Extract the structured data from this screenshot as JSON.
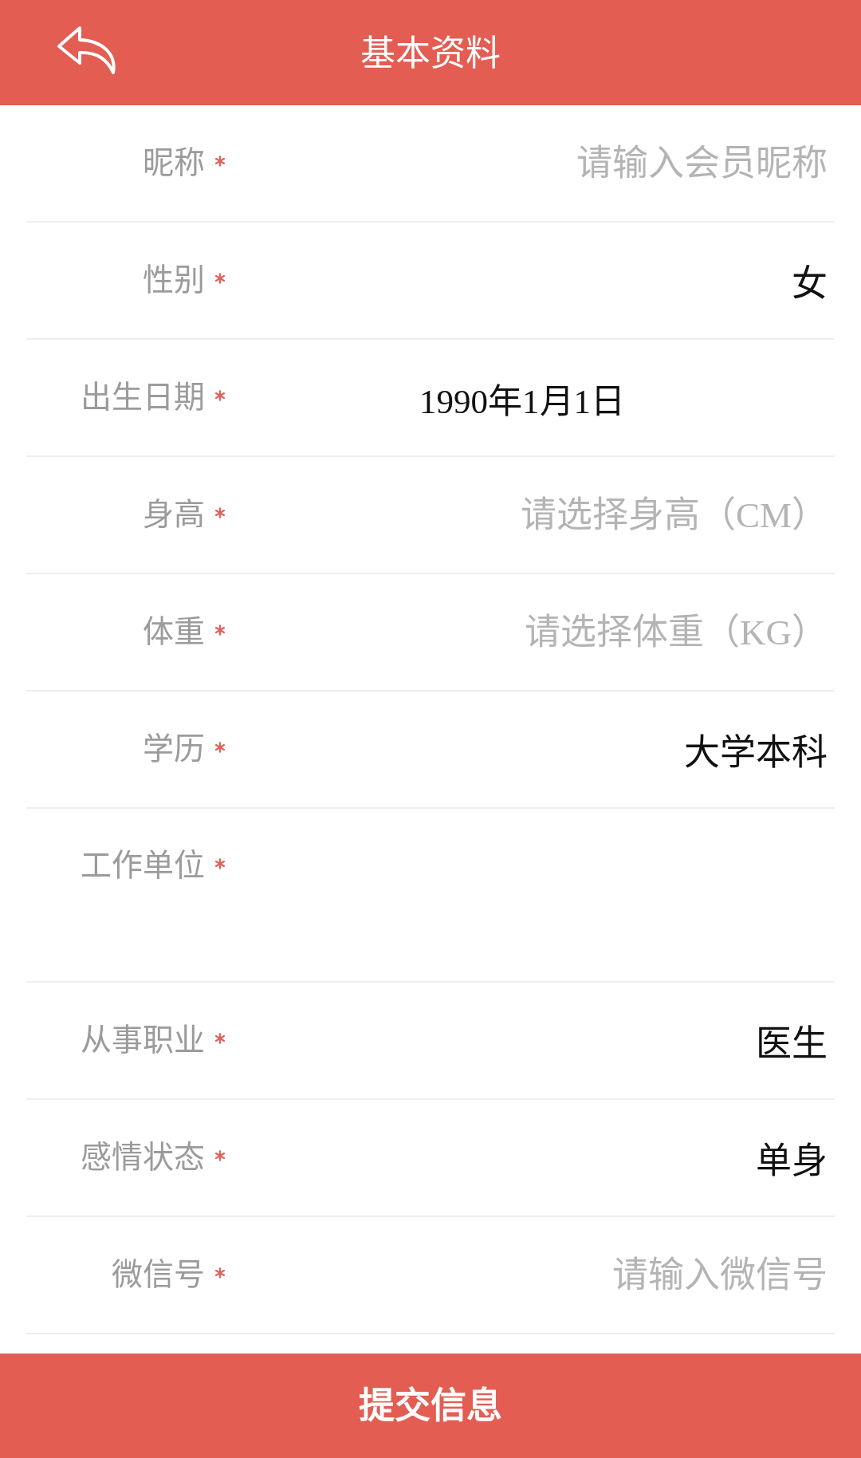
{
  "header": {
    "title": "基本资料"
  },
  "fields": [
    {
      "label": "昵称",
      "required": true,
      "kind": "text",
      "placeholder": "请输入会员昵称"
    },
    {
      "label": "性别",
      "required": true,
      "kind": "picker",
      "value": "女"
    },
    {
      "label": "出生日期",
      "required": true,
      "kind": "date",
      "value": "1990年1月1日"
    },
    {
      "label": "身高",
      "required": true,
      "kind": "picker",
      "placeholder": "请选择身高（CM）"
    },
    {
      "label": "体重",
      "required": true,
      "kind": "picker",
      "placeholder": "请选择体重（KG）"
    },
    {
      "label": "学历",
      "required": true,
      "kind": "picker",
      "value": "大学本科"
    },
    {
      "label": "工作单位",
      "required": true,
      "kind": "textarea"
    },
    {
      "label": "从事职业",
      "required": true,
      "kind": "picker",
      "value": "医生"
    },
    {
      "label": "感情状态",
      "required": true,
      "kind": "picker",
      "value": "单身"
    },
    {
      "label": "微信号",
      "required": true,
      "kind": "text",
      "placeholder": "请输入微信号"
    }
  ],
  "submit_button": {
    "label": "提交信息"
  }
}
